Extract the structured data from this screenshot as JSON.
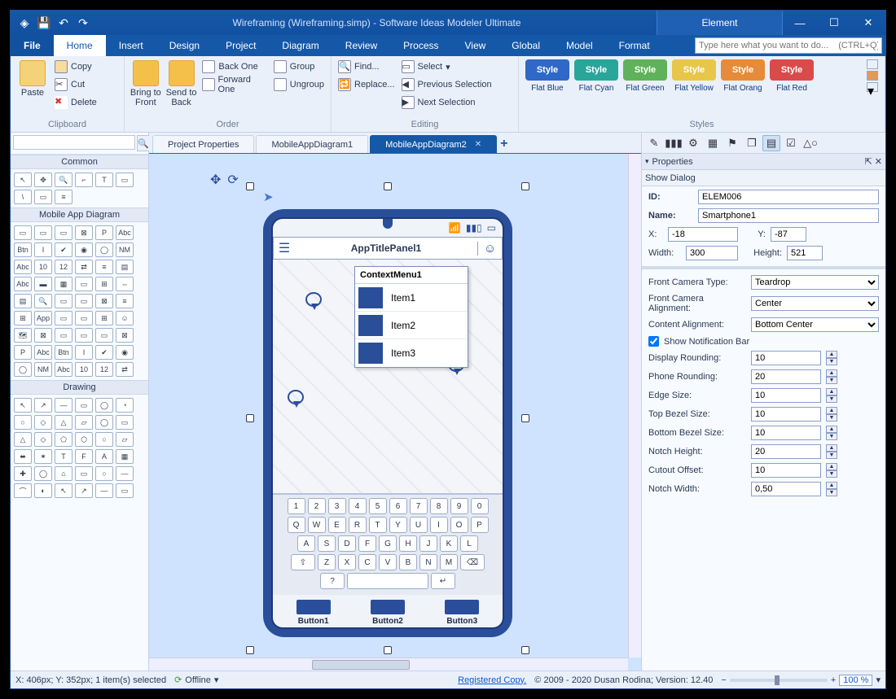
{
  "titlebar": {
    "title": "Wireframing (Wireframing.simp) - Software Ideas Modeler Ultimate",
    "element_tab": "Element"
  },
  "menu": [
    "File",
    "Home",
    "Insert",
    "Design",
    "Project",
    "Diagram",
    "Review",
    "Process",
    "View",
    "Global",
    "Model",
    "Format"
  ],
  "help_placeholder": "Type here what you want to do...    (CTRL+Q)",
  "ribbon": {
    "clipboard": {
      "caption": "Clipboard",
      "paste": "Paste",
      "copy": "Copy",
      "cut": "Cut",
      "delete": "Delete"
    },
    "order": {
      "caption": "Order",
      "bring_front": "Bring to Front",
      "send_back": "Send to Back",
      "back_one": "Back One",
      "forward_one": "Forward One",
      "group": "Group",
      "ungroup": "Ungroup"
    },
    "editing": {
      "caption": "Editing",
      "find": "Find...",
      "replace": "Replace...",
      "select": "Select",
      "prev_sel": "Previous Selection",
      "next_sel": "Next Selection"
    },
    "styles": {
      "caption": "Styles",
      "items": [
        {
          "label": "Style",
          "name": "Flat Blue",
          "bg": "#2f68c6"
        },
        {
          "label": "Style",
          "name": "Flat Cyan",
          "bg": "#2aa59a"
        },
        {
          "label": "Style",
          "name": "Flat Green",
          "bg": "#5fb25a"
        },
        {
          "label": "Style",
          "name": "Flat Yellow",
          "bg": "#e8c64a"
        },
        {
          "label": "Style",
          "name": "Flat Orang",
          "bg": "#e58b3a"
        },
        {
          "label": "Style",
          "name": "Flat Red",
          "bg": "#d94b4b"
        }
      ]
    }
  },
  "left": {
    "common": "Common",
    "mobile": "Mobile App Diagram",
    "drawing": "Drawing"
  },
  "tabs": [
    {
      "label": "Project Properties",
      "active": false
    },
    {
      "label": "MobileAppDiagram1",
      "active": false
    },
    {
      "label": "MobileAppDiagram2",
      "active": true
    }
  ],
  "phone": {
    "app_title": "AppTitlePanel1",
    "context_title": "ContextMenu1",
    "items": [
      "Item1",
      "Item2",
      "Item3"
    ],
    "buttons": [
      "Button1",
      "Button2",
      "Button3"
    ],
    "kb_rows": [
      [
        "1",
        "2",
        "3",
        "4",
        "5",
        "6",
        "7",
        "8",
        "9",
        "0"
      ],
      [
        "Q",
        "W",
        "E",
        "R",
        "T",
        "Y",
        "U",
        "I",
        "O",
        "P"
      ],
      [
        "A",
        "S",
        "D",
        "F",
        "G",
        "H",
        "J",
        "K",
        "L"
      ],
      [
        "⇧",
        "Z",
        "X",
        "C",
        "V",
        "B",
        "N",
        "M",
        "⌫"
      ],
      [
        "?",
        "␣",
        "↵"
      ]
    ]
  },
  "props": {
    "panel_title": "Properties",
    "dialog": "Show Dialog",
    "id_label": "ID:",
    "id": "ELEM006",
    "name_label": "Name:",
    "name": "Smartphone1",
    "x_label": "X:",
    "x": "-18",
    "y_label": "Y:",
    "y": "-87",
    "w_label": "Width:",
    "w": "300",
    "h_label": "Height:",
    "h": "521",
    "front_cam_type_label": "Front Camera Type:",
    "front_cam_type": "Teardrop",
    "front_cam_align_label": "Front Camera Alignment:",
    "front_cam_align": "Center",
    "content_align_label": "Content Alignment:",
    "content_align": "Bottom Center",
    "show_notif_label": "Show Notification Bar",
    "show_notif": true,
    "display_rounding_label": "Display Rounding:",
    "display_rounding": "10",
    "phone_rounding_label": "Phone Rounding:",
    "phone_rounding": "20",
    "edge_size_label": "Edge Size:",
    "edge_size": "10",
    "top_bezel_label": "Top Bezel Size:",
    "top_bezel": "10",
    "bottom_bezel_label": "Bottom Bezel Size:",
    "bottom_bezel": "10",
    "notch_height_label": "Notch Height:",
    "notch_height": "20",
    "cutout_offset_label": "Cutout Offset:",
    "cutout_offset": "10",
    "notch_width_label": "Notch Width:",
    "notch_width": "0,50"
  },
  "status": {
    "pos": "X: 406px; Y: 352px; 1 item(s) selected",
    "offline": "Offline",
    "registered": "Registered Copy.",
    "copyright": "© 2009 - 2020 Dusan Rodina; Version: 12.40",
    "zoom": "100 %"
  }
}
